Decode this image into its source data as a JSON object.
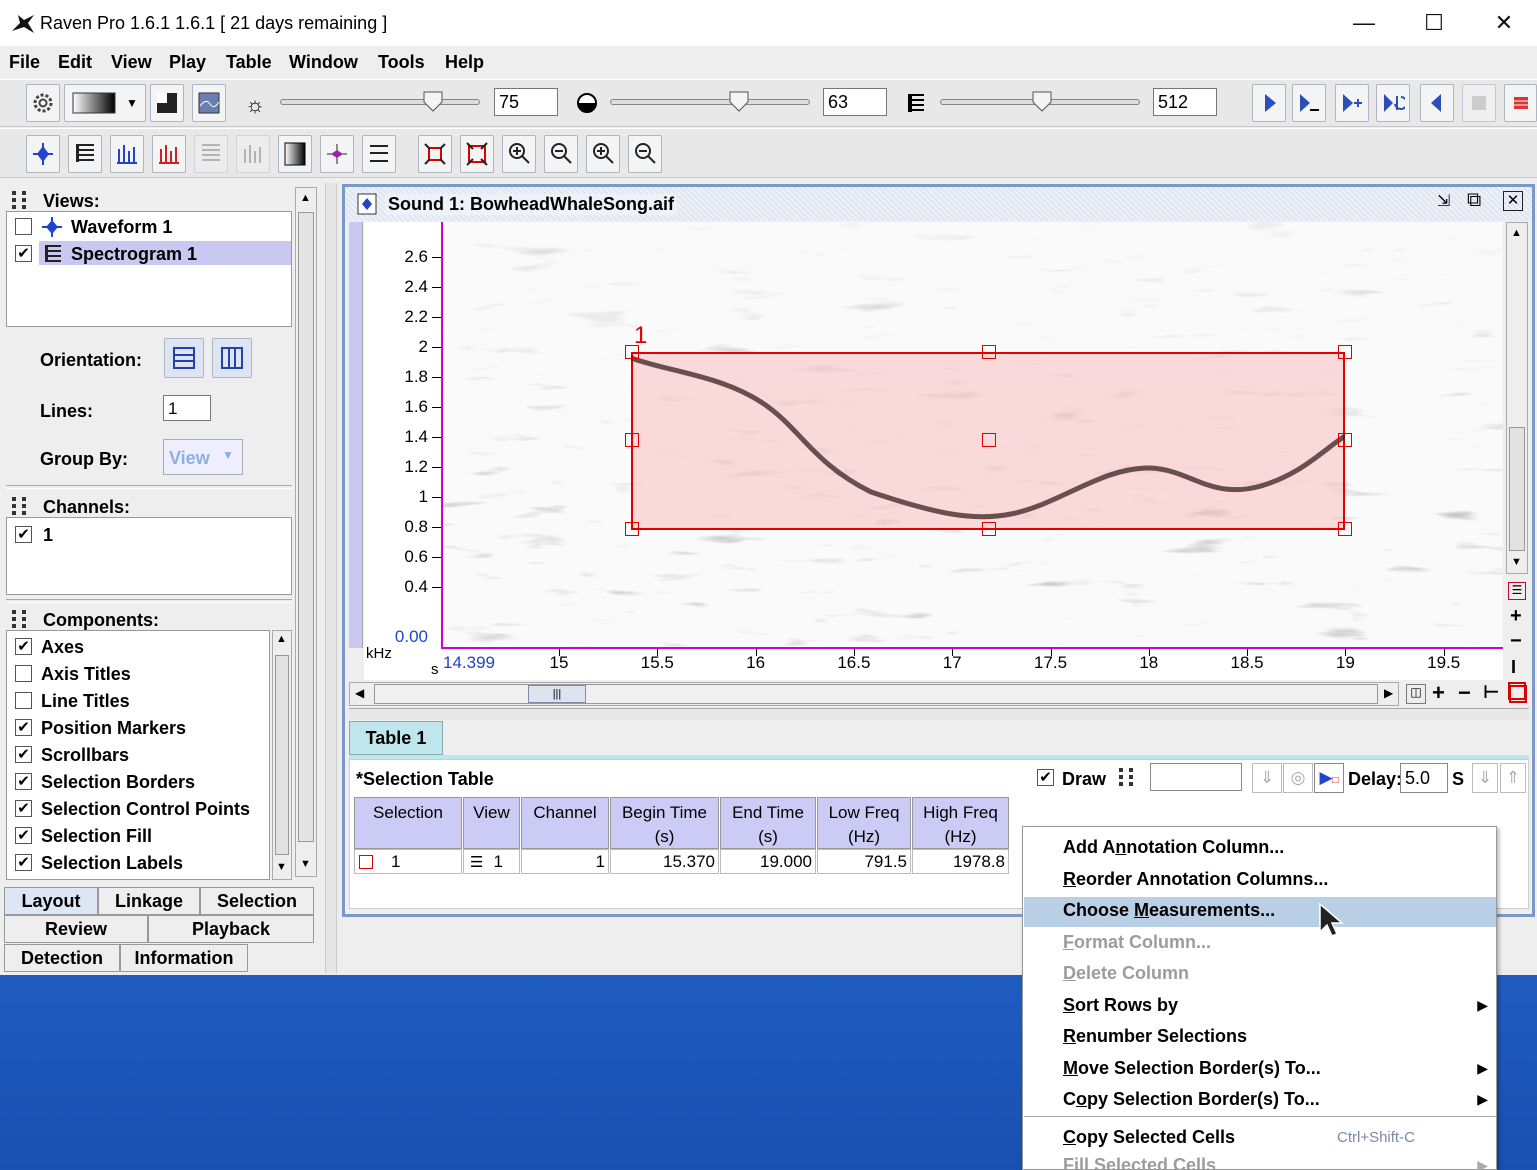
{
  "window": {
    "title": "Raven Pro 1.6.1 1.6.1  [ 21 days remaining ]"
  },
  "menu": [
    "File",
    "Edit",
    "View",
    "Play",
    "Table",
    "Window",
    "Tools",
    "Help"
  ],
  "toolbar": {
    "brightness_value": "75",
    "contrast_value": "63",
    "size_value": "512"
  },
  "left_panel": {
    "views_header": "Views:",
    "views": [
      {
        "label": "Waveform 1",
        "checked": false
      },
      {
        "label": "Spectrogram 1",
        "checked": true
      }
    ],
    "orientation_label": "Orientation:",
    "lines_label": "Lines:",
    "lines_value": "1",
    "group_by_label": "Group By:",
    "group_by_value": "View",
    "channels_header": "Channels:",
    "channels": [
      {
        "label": "1",
        "checked": true
      }
    ],
    "components_header": "Components:",
    "components": [
      {
        "label": "Axes",
        "checked": true
      },
      {
        "label": "Axis Titles",
        "checked": false
      },
      {
        "label": "Line Titles",
        "checked": false
      },
      {
        "label": "Position Markers",
        "checked": true
      },
      {
        "label": "Scrollbars",
        "checked": true
      },
      {
        "label": "Selection Borders",
        "checked": true
      },
      {
        "label": "Selection Control Points",
        "checked": true
      },
      {
        "label": "Selection Fill",
        "checked": true
      },
      {
        "label": "Selection Labels",
        "checked": true
      }
    ],
    "tabs": [
      "Layout",
      "Linkage",
      "Selection",
      "Review",
      "Playback",
      "Detection",
      "Information"
    ]
  },
  "sound": {
    "title": "Sound 1: BowheadWhaleSong.aif",
    "selection_label": "1",
    "y_axis": {
      "unit": "kHz",
      "ticks": [
        "2.6",
        "2.4",
        "2.2",
        "2",
        "1.8",
        "1.6",
        "1.4",
        "1.2",
        "1",
        "0.8",
        "0.6",
        "0.4"
      ],
      "origin": "0.00"
    },
    "x_axis": {
      "unit": "s",
      "start": "14.399",
      "ticks": [
        "15",
        "15.5",
        "16",
        "16.5",
        "17",
        "17.5",
        "18",
        "18.5",
        "19",
        "19.5"
      ]
    }
  },
  "table": {
    "tab": "Table 1",
    "title": "*Selection Table",
    "draw_label": "Draw",
    "delay_label": "Delay:",
    "delay_value": "5.0",
    "delay_unit": "S",
    "columns": [
      {
        "line1": "Selection",
        "line2": ""
      },
      {
        "line1": "View",
        "line2": ""
      },
      {
        "line1": "Channel",
        "line2": ""
      },
      {
        "line1": "Begin Time",
        "line2": "(s)"
      },
      {
        "line1": "End Time",
        "line2": "(s)"
      },
      {
        "line1": "Low Freq",
        "line2": "(Hz)"
      },
      {
        "line1": "High Freq",
        "line2": "(Hz)"
      }
    ],
    "row": {
      "selection": "1",
      "view": "1",
      "channel": "1",
      "begin": "15.370",
      "end": "19.000",
      "low": "791.5",
      "high": "1978.8"
    }
  },
  "context_menu": {
    "items": [
      {
        "pre": "Add A",
        "u": "n",
        "post": "notation Column...",
        "disabled": false,
        "submenu": false
      },
      {
        "pre": "",
        "u": "R",
        "post": "eorder Annotation Columns...",
        "disabled": false,
        "submenu": false
      },
      {
        "pre": "Choose ",
        "u": "M",
        "post": "easurements...",
        "disabled": false,
        "submenu": false,
        "highlighted": true
      },
      {
        "pre": "",
        "u": "F",
        "post": "ormat Column...",
        "disabled": true,
        "submenu": false
      },
      {
        "pre": "",
        "u": "D",
        "post": "elete Column",
        "disabled": true,
        "submenu": false
      },
      {
        "pre": "",
        "u": "S",
        "post": "ort Rows by",
        "disabled": false,
        "submenu": true
      },
      {
        "pre": "",
        "u": "R",
        "post": "enumber Selections",
        "disabled": false,
        "submenu": false
      },
      {
        "pre": "",
        "u": "M",
        "post": "ove Selection Border(s) To...",
        "disabled": false,
        "submenu": true
      },
      {
        "pre": "C",
        "u": "o",
        "post": "py Selection Border(s) To...",
        "disabled": false,
        "submenu": true
      },
      {
        "pre": "",
        "u": "C",
        "post": "opy Selected Cells",
        "disabled": false,
        "submenu": false,
        "shortcut": "Ctrl+Shift-C"
      },
      {
        "pre": "Fill Selected Cells",
        "u": "",
        "post": "",
        "disabled": true,
        "submenu": true
      }
    ]
  },
  "colors": {
    "selection_border": "#e00000",
    "selection_fill": "#f7c8c8",
    "table_header": "#cbcbf5",
    "menu_highlight": "#b8cfe5"
  }
}
